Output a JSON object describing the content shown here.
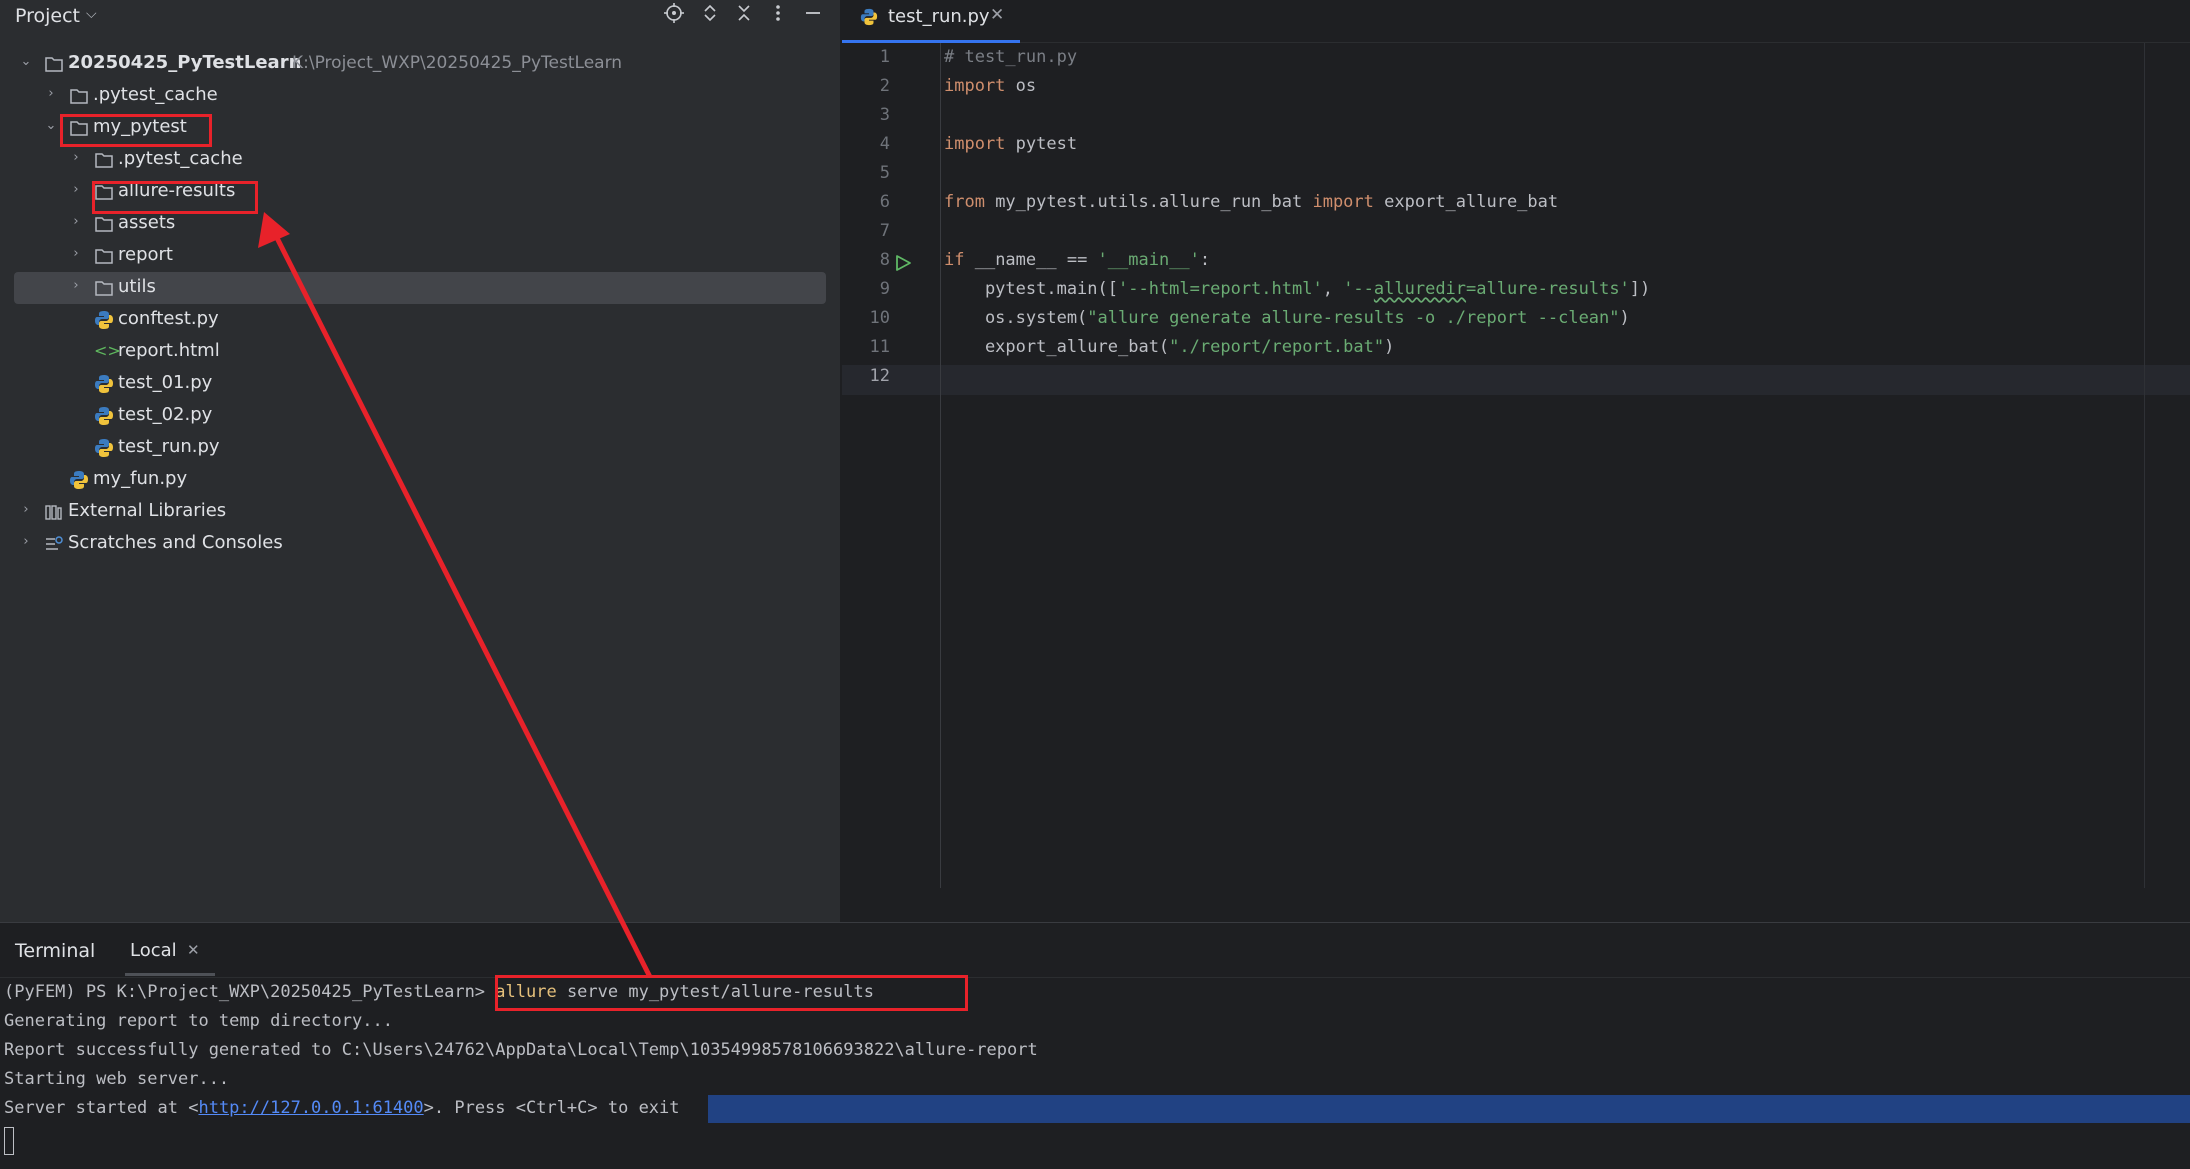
{
  "project_panel": {
    "title": "Project",
    "header_icons": [
      "locate-icon",
      "expand-collapse-icon",
      "collapse-all-icon",
      "more-options-icon",
      "minimize-icon"
    ],
    "tree": [
      {
        "label": "20250425_PyTestLearn",
        "path": "K:\\Project_WXP\\20250425_PyTestLearn",
        "type": "folder",
        "expanded": true
      },
      {
        "label": ".pytest_cache",
        "type": "folder",
        "expanded": false
      },
      {
        "label": "my_pytest",
        "type": "folder",
        "expanded": true
      },
      {
        "label": ".pytest_cache",
        "type": "folder",
        "expanded": false
      },
      {
        "label": "allure-results",
        "type": "folder",
        "expanded": false
      },
      {
        "label": "assets",
        "type": "folder",
        "expanded": false
      },
      {
        "label": "report",
        "type": "folder",
        "expanded": false
      },
      {
        "label": "utils",
        "type": "folder",
        "expanded": false,
        "selected": true
      },
      {
        "label": "conftest.py",
        "type": "python"
      },
      {
        "label": "report.html",
        "type": "html"
      },
      {
        "label": "test_01.py",
        "type": "python"
      },
      {
        "label": "test_02.py",
        "type": "python"
      },
      {
        "label": "test_run.py",
        "type": "python"
      },
      {
        "label": "my_fun.py",
        "type": "python"
      },
      {
        "label": "External Libraries",
        "type": "library",
        "expanded": false
      },
      {
        "label": "Scratches and Consoles",
        "type": "scratches",
        "expanded": false
      }
    ]
  },
  "editor": {
    "tab_label": "test_run.py",
    "current_line": "12",
    "line_numbers": [
      "1",
      "2",
      "3",
      "4",
      "5",
      "6",
      "7",
      "8",
      "9",
      "10",
      "11",
      "12"
    ],
    "code": {
      "l1_comment": "# test_run.py",
      "l2_kw": "import",
      "l2_rest": " os",
      "l4_kw": "import",
      "l4_rest": " pytest",
      "l6_kw1": "from",
      "l6_mod": " my_pytest.utils.allure_run_bat ",
      "l6_kw2": "import",
      "l6_rest": " export_allure_bat",
      "l8_kw": "if",
      "l8_mid": " __name__ == ",
      "l8_str": "'__main__'",
      "l8_end": ":",
      "l9_a": "    pytest.main([",
      "l9_s1": "'--html=report.html'",
      "l9_b": ", ",
      "l9_s2a": "'--",
      "l9_s2b": "alluredir",
      "l9_s2c": "=allure-results'",
      "l9_c": "])",
      "l10_a": "    os.system(",
      "l10_s": "\"allure generate allure-results -o ./report --clean\"",
      "l10_b": ")",
      "l11_a": "    export_allure_bat(",
      "l11_s": "\"./report/report.bat\"",
      "l11_b": ")"
    }
  },
  "terminal": {
    "title": "Terminal",
    "tab_label": "Local",
    "prompt": "(PyFEM) PS K:\\Project_WXP\\20250425_PyTestLearn> ",
    "cmd_name": "allure",
    "cmd_args": " serve my_pytest/allure-results",
    "line2": "Generating report to temp directory...",
    "line3": "Report successfully generated to C:\\Users\\24762\\AppData\\Local\\Temp\\10354998578106693822\\allure-report",
    "line4": "Starting web server...",
    "line5_prefix": "Server started at <",
    "line5_link": "http://127.0.0.1:61400",
    "line5_suffix": ">. Press <Ctrl+C> to exit"
  },
  "colors": {
    "annotation": "#e8222a",
    "accent": "#3574f0",
    "selection": "#214283"
  }
}
